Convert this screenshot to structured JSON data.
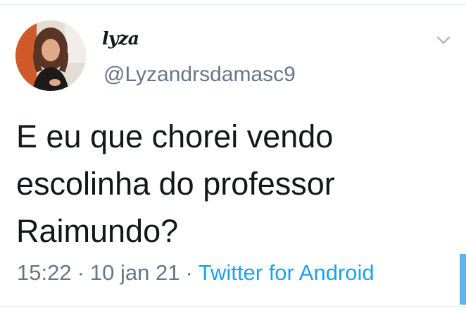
{
  "tweet": {
    "display_name": "lyza",
    "handle": "@Lyzandrsdamasc9",
    "text": "E eu que chorei vendo\nescolinha do professor\nRaimundo?",
    "time": "15:22",
    "separator": "·",
    "date": "10 jan 21",
    "source": "Twitter for Android"
  },
  "icons": {
    "more": "chevron-down-icon",
    "avatar": "profile-photo"
  },
  "colors": {
    "text_primary": "#14171a",
    "text_secondary": "#657786",
    "link": "#1da1f2",
    "divider": "#e6ecf0"
  }
}
